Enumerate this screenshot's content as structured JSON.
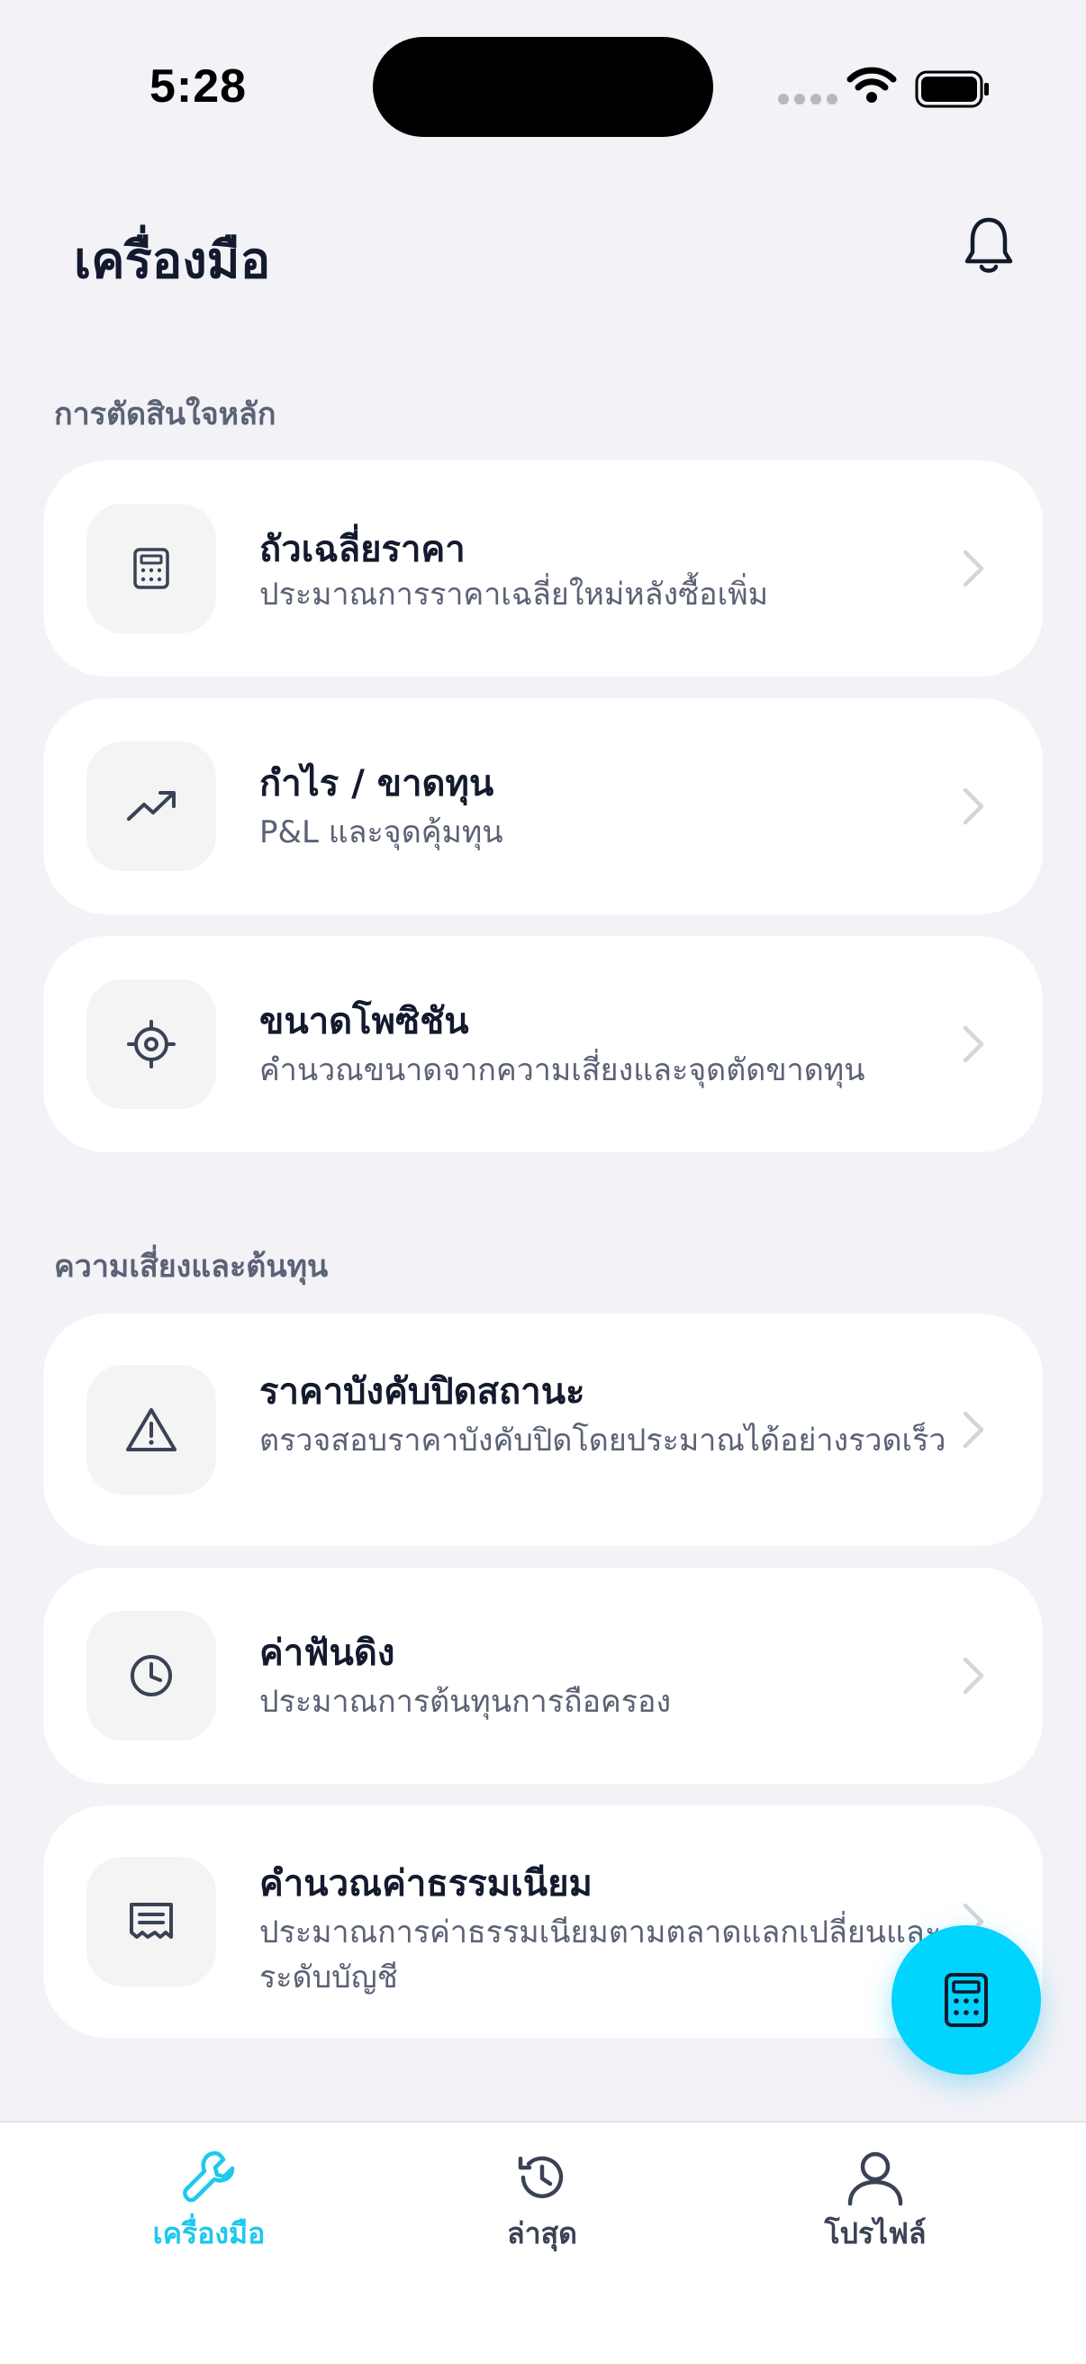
{
  "status_bar": {
    "time": "5:28"
  },
  "header": {
    "title": "เครื่องมือ",
    "bell_icon": "bell-icon"
  },
  "sections": [
    {
      "title": "การตัดสินใจหลัก",
      "items": [
        {
          "title": "ถัวเฉลี่ยราคา",
          "subtitle": "ประมาณการราคาเฉลี่ยใหม่หลังซื้อเพิ่ม",
          "icon": "calculator-icon"
        },
        {
          "title": "กำไร / ขาดทุน",
          "subtitle": "P&L และจุดคุ้มทุน",
          "icon": "trending-up-icon"
        },
        {
          "title": "ขนาดโพซิชัน",
          "subtitle": "คำนวณขนาดจากความเสี่ยงและจุดตัดขาดทุน",
          "icon": "crosshair-icon"
        }
      ]
    },
    {
      "title": "ความเสี่ยงและต้นทุน",
      "items": [
        {
          "title": "ราคาบังคับปิดสถานะ",
          "subtitle": "ตรวจสอบราคาบังคับปิดโดยประมาณได้อย่างรวดเร็ว",
          "icon": "warning-icon"
        },
        {
          "title": "ค่าฟันดิง",
          "subtitle": "ประมาณการต้นทุนการถือครอง",
          "icon": "clock-icon"
        },
        {
          "title": "คำนวณค่าธรรมเนียม",
          "subtitle": "ประมาณการค่าธรรมเนียมตามตลาดแลกเปลี่ยนและระดับบัญชี",
          "icon": "receipt-icon"
        }
      ]
    }
  ],
  "fab": {
    "icon": "calculator-icon"
  },
  "tabbar": {
    "tabs": [
      {
        "label": "เครื่องมือ",
        "icon": "wrench-icon",
        "active": true
      },
      {
        "label": "ล่าสุด",
        "icon": "history-icon",
        "active": false
      },
      {
        "label": "โปรไฟล์",
        "icon": "user-icon",
        "active": false
      }
    ]
  },
  "colors": {
    "accent": "#00d4ff",
    "active_tab": "#1ec8ee",
    "text": "#141a2e",
    "muted": "#5b6275",
    "background": "#f2f2f7"
  }
}
